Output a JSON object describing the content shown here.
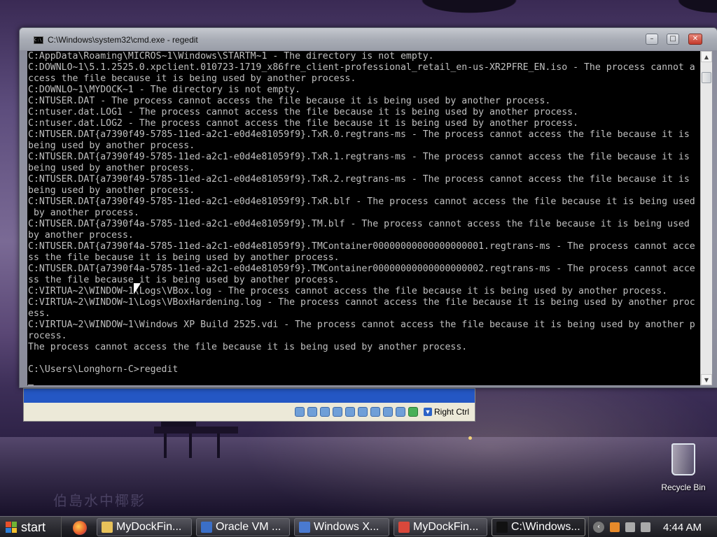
{
  "window": {
    "title": "C:\\Windows\\system32\\cmd.exe - regedit",
    "minimize_glyph": "–",
    "maximize_glyph": "□",
    "close_glyph": "✕"
  },
  "console_lines": [
    "C:AppData\\Roaming\\MICROS~1\\Windows\\STARTM~1 - The directory is not empty.",
    "C:DOWNLO~1\\5.1.2525.0.xpclient.010723-1719_x86fre_client-professional_retail_en-us-XR2PFRE_EN.iso - The process cannot a",
    "ccess the file because it is being used by another process.",
    "C:DOWNLO~1\\MYDOCK~1 - The directory is not empty.",
    "C:NTUSER.DAT - The process cannot access the file because it is being used by another process.",
    "C:ntuser.dat.LOG1 - The process cannot access the file because it is being used by another process.",
    "C:ntuser.dat.LOG2 - The process cannot access the file because it is being used by another process.",
    "C:NTUSER.DAT{a7390f49-5785-11ed-a2c1-e0d4e81059f9}.TxR.0.regtrans-ms - The process cannot access the file because it is",
    "being used by another process.",
    "C:NTUSER.DAT{a7390f49-5785-11ed-a2c1-e0d4e81059f9}.TxR.1.regtrans-ms - The process cannot access the file because it is",
    "being used by another process.",
    "C:NTUSER.DAT{a7390f49-5785-11ed-a2c1-e0d4e81059f9}.TxR.2.regtrans-ms - The process cannot access the file because it is",
    "being used by another process.",
    "C:NTUSER.DAT{a7390f49-5785-11ed-a2c1-e0d4e81059f9}.TxR.blf - The process cannot access the file because it is being used",
    " by another process.",
    "C:NTUSER.DAT{a7390f4a-5785-11ed-a2c1-e0d4e81059f9}.TM.blf - The process cannot access the file because it is being used",
    "by another process.",
    "C:NTUSER.DAT{a7390f4a-5785-11ed-a2c1-e0d4e81059f9}.TMContainer00000000000000000001.regtrans-ms - The process cannot acce",
    "ss the file because it is being used by another process.",
    "C:NTUSER.DAT{a7390f4a-5785-11ed-a2c1-e0d4e81059f9}.TMContainer00000000000000000002.regtrans-ms - The process cannot acce",
    "ss the file because it is being used by another process.",
    "C:VIRTUA~2\\WINDOW~1\\Logs\\VBox.log - The process cannot access the file because it is being used by another process.",
    "C:VIRTUA~2\\WINDOW~1\\Logs\\VBoxHardening.log - The process cannot access the file because it is being used by another proc",
    "ess.",
    "C:VIRTUA~2\\WINDOW~1\\Windows XP Build 2525.vdi - The process cannot access the file because it is being used by another p",
    "rocess.",
    "The process cannot access the file because it is being used by another process.",
    "",
    "C:\\Users\\Longhorn-C>regedit"
  ],
  "vbox": {
    "host_key_label": "Right Ctrl"
  },
  "desktop": {
    "recycle_bin_label": "Recycle Bin",
    "watermark": "伯島水中椰影"
  },
  "taskbar": {
    "start_label": "start",
    "buttons": [
      {
        "label": "MyDockFin...",
        "icon": "folder-icon",
        "color": "#e8c25a"
      },
      {
        "label": "Oracle VM ...",
        "icon": "virtualbox-icon",
        "color": "#3b6fc7"
      },
      {
        "label": "Windows X...",
        "icon": "windows-vm-icon",
        "color": "#4a7ad0"
      },
      {
        "label": "MyDockFin...",
        "icon": "chrome-icon",
        "color": "#d9483b"
      },
      {
        "label": "C:\\Windows...",
        "icon": "cmd-icon",
        "color": "#111111"
      }
    ],
    "clock": "4:44 AM"
  }
}
